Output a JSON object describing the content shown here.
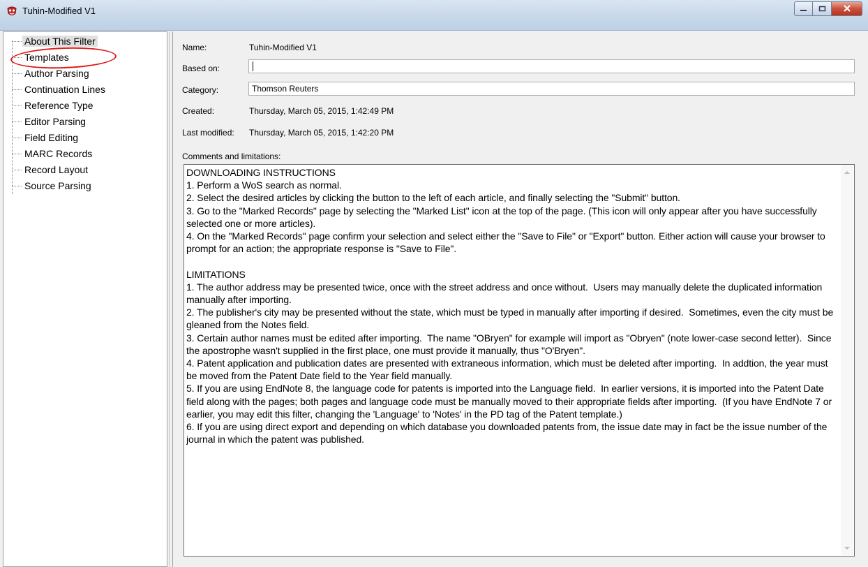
{
  "window": {
    "title": "Tuhin-Modified V1",
    "icons": {
      "app": "endnote-filter-icon",
      "minimize": "minimize-icon",
      "maximize": "maximize-icon",
      "close": "close-icon"
    }
  },
  "tree": {
    "items": [
      {
        "label": "About This Filter",
        "selected": true
      },
      {
        "label": "Templates",
        "selected": false
      },
      {
        "label": "Author Parsing",
        "selected": false
      },
      {
        "label": "Continuation Lines",
        "selected": false
      },
      {
        "label": "Reference Type",
        "selected": false
      },
      {
        "label": "Editor Parsing",
        "selected": false
      },
      {
        "label": "Field Editing",
        "selected": false
      },
      {
        "label": "MARC Records",
        "selected": false
      },
      {
        "label": "Record Layout",
        "selected": false
      },
      {
        "label": "Source Parsing",
        "selected": false
      }
    ],
    "annotation_color": "#e01a1a"
  },
  "about": {
    "name_label": "Name:",
    "name_value": "Tuhin-Modified V1",
    "based_on_label": "Based on:",
    "based_on_value": "",
    "category_label": "Category:",
    "category_value": "Thomson Reuters",
    "created_label": "Created:",
    "created_value": "Thursday, March 05, 2015, 1:42:49 PM",
    "modified_label": "Last modified:",
    "modified_value": "Thursday, March 05, 2015, 1:42:20 PM",
    "comments_label": "Comments and limitations:",
    "comments_text": "DOWNLOADING INSTRUCTIONS\n1. Perform a WoS search as normal.\n2. Select the desired articles by clicking the button to the left of each article, and finally selecting the \"Submit\" button.\n3. Go to the \"Marked Records\" page by selecting the \"Marked List\" icon at the top of the page. (This icon will only appear after you have successfully selected one or more articles).\n4. On the \"Marked Records\" page confirm your selection and select either the \"Save to File\" or \"Export\" button. Either action will cause your browser to prompt for an action; the appropriate response is \"Save to File\".\n\nLIMITATIONS\n1. The author address may be presented twice, once with the street address and once without.  Users may manually delete the duplicated information manually after importing.\n2. The publisher's city may be presented without the state, which must be typed in manually after importing if desired.  Sometimes, even the city must be gleaned from the Notes field.\n3. Certain author names must be edited after importing.  The name \"OBryen\" for example will import as \"Obryen\" (note lower-case second letter).  Since the apostrophe wasn't supplied in the first place, one must provide it manually, thus \"O'Bryen\".\n4. Patent application and publication dates are presented with extraneous information, which must be deleted after importing.  In addtion, the year must be moved from the Patent Date field to the Year field manually.\n5. If you are using EndNote 8, the language code for patents is imported into the Language field.  In earlier versions, it is imported into the Patent Date field along with the pages; both pages and language code must be manually moved to their appropriate fields after importing.  (If you have EndNote 7 or earlier, you may edit this filter, changing the 'Language' to 'Notes' in the PD tag of the Patent template.)\n6. If you are using direct export and depending on which database you downloaded patents from, the issue date may in fact be the issue number of the journal in which the patent was published."
  }
}
